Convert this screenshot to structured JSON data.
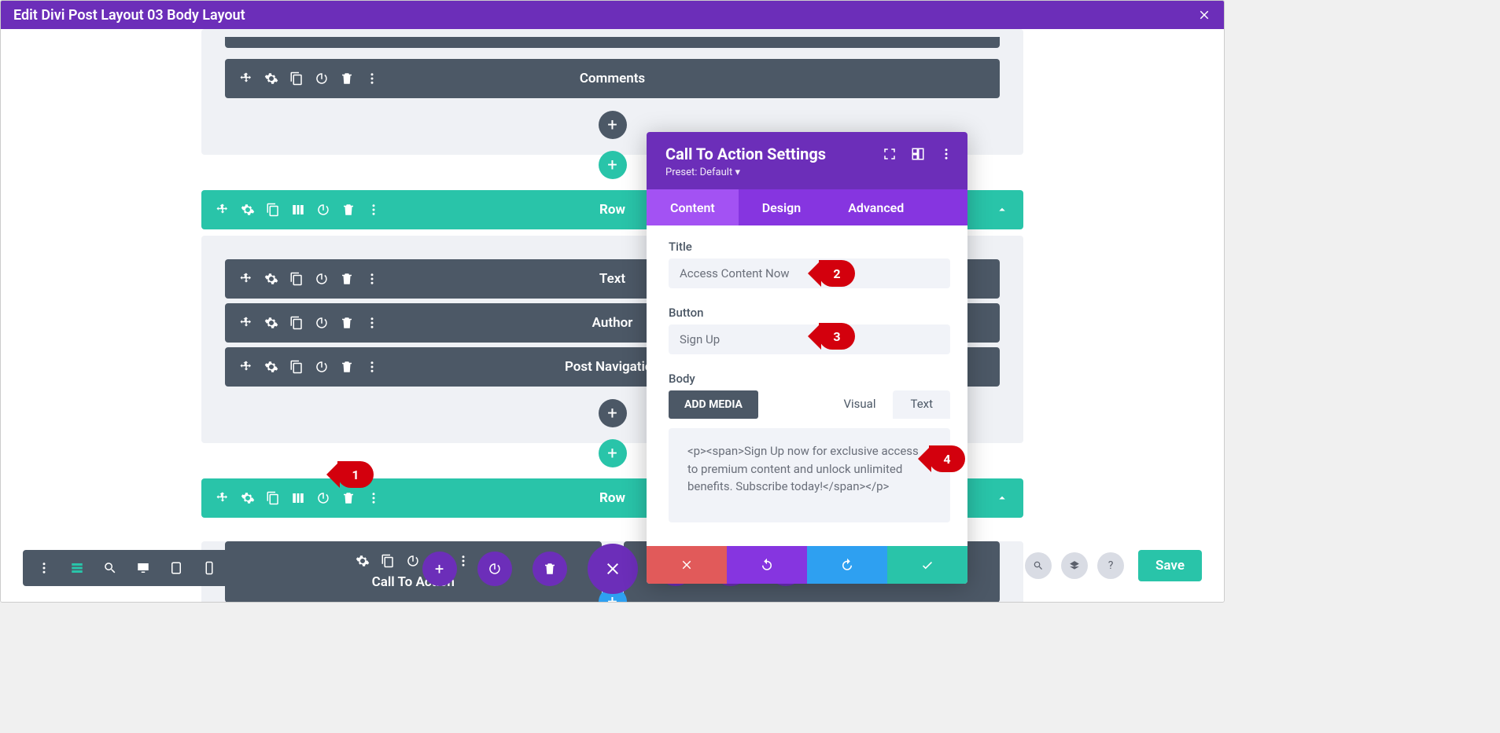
{
  "top_bar": {
    "title": "Edit Divi Post Layout 03 Body Layout"
  },
  "modules": {
    "comments": "Comments",
    "text": "Text",
    "author": "Author",
    "post_nav": "Post Navigation",
    "cta": "Call To Action"
  },
  "row_label": "Row",
  "modal": {
    "title": "Call To Action Settings",
    "preset_label": "Preset: Default",
    "tabs": {
      "content": "Content",
      "design": "Design",
      "advanced": "Advanced"
    },
    "fields": {
      "title_label": "Title",
      "title_value": "Access Content Now",
      "button_label": "Button",
      "button_value": "Sign Up",
      "body_label": "Body",
      "add_media": "ADD MEDIA",
      "editor_tabs": {
        "visual": "Visual",
        "text": "Text"
      },
      "body_value": "<p><span>Sign Up now for exclusive access to premium content and unlock unlimited benefits. Subscribe today!</span></p>"
    }
  },
  "pins": {
    "1": "1",
    "2": "2",
    "3": "3",
    "4": "4"
  },
  "bottom": {
    "save": "Save"
  }
}
